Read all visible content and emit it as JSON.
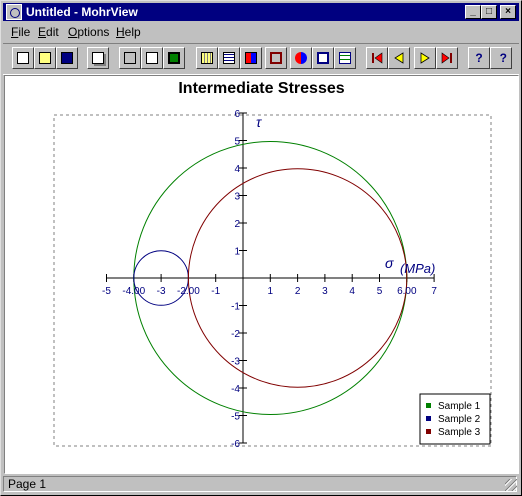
{
  "window": {
    "title": "Untitled - MohrView"
  },
  "menu": [
    {
      "label": "File",
      "u": "F"
    },
    {
      "label": "Edit",
      "u": "E"
    },
    {
      "label": "Options",
      "u": "O"
    },
    {
      "label": "Help",
      "u": "H"
    }
  ],
  "toolbar": {
    "buttons": [
      "new-file",
      "open-folder",
      "save",
      "copy",
      "print",
      "page-frame",
      "page-setup",
      "grid",
      "table",
      "color-palette",
      "stress-element",
      "mohr-circle",
      "format",
      "legend",
      "first-page",
      "previous-page",
      "next-page",
      "last-page",
      "help",
      "context-help"
    ]
  },
  "status": {
    "text": "Page 1"
  },
  "colors": {
    "sample1": "#008000",
    "sample2": "#000080",
    "sample3": "#800000",
    "axis": "#000080",
    "titlebar": "#000080"
  },
  "chart_data": {
    "type": "scatter",
    "title": "Intermediate Stresses",
    "xlabel": "σ",
    "xunit": "(MPa)",
    "ylabel": "τ",
    "xlim": [
      -5,
      7
    ],
    "ylim": [
      -6,
      6
    ],
    "xticks": [
      -5,
      -4,
      -3,
      -2,
      -1,
      0,
      1,
      2,
      3,
      4,
      5,
      6,
      7
    ],
    "yticks": [
      -6,
      -5,
      -4,
      -3,
      -2,
      -1,
      1,
      2,
      3,
      4,
      5,
      6
    ],
    "point_labels": [
      {
        "x": -4,
        "text": "-4.00"
      },
      {
        "x": -2,
        "text": "-2.00"
      },
      {
        "x": 6,
        "text": "6.00"
      }
    ],
    "series": [
      {
        "name": "Sample 1",
        "center": 1,
        "radius": 5,
        "color": "#008000"
      },
      {
        "name": "Sample 2",
        "center": -3,
        "radius": 1,
        "color": "#000080"
      },
      {
        "name": "Sample 3",
        "center": 2,
        "radius": 4,
        "color": "#800000"
      }
    ],
    "legend": "bottom-right",
    "grid": false
  }
}
